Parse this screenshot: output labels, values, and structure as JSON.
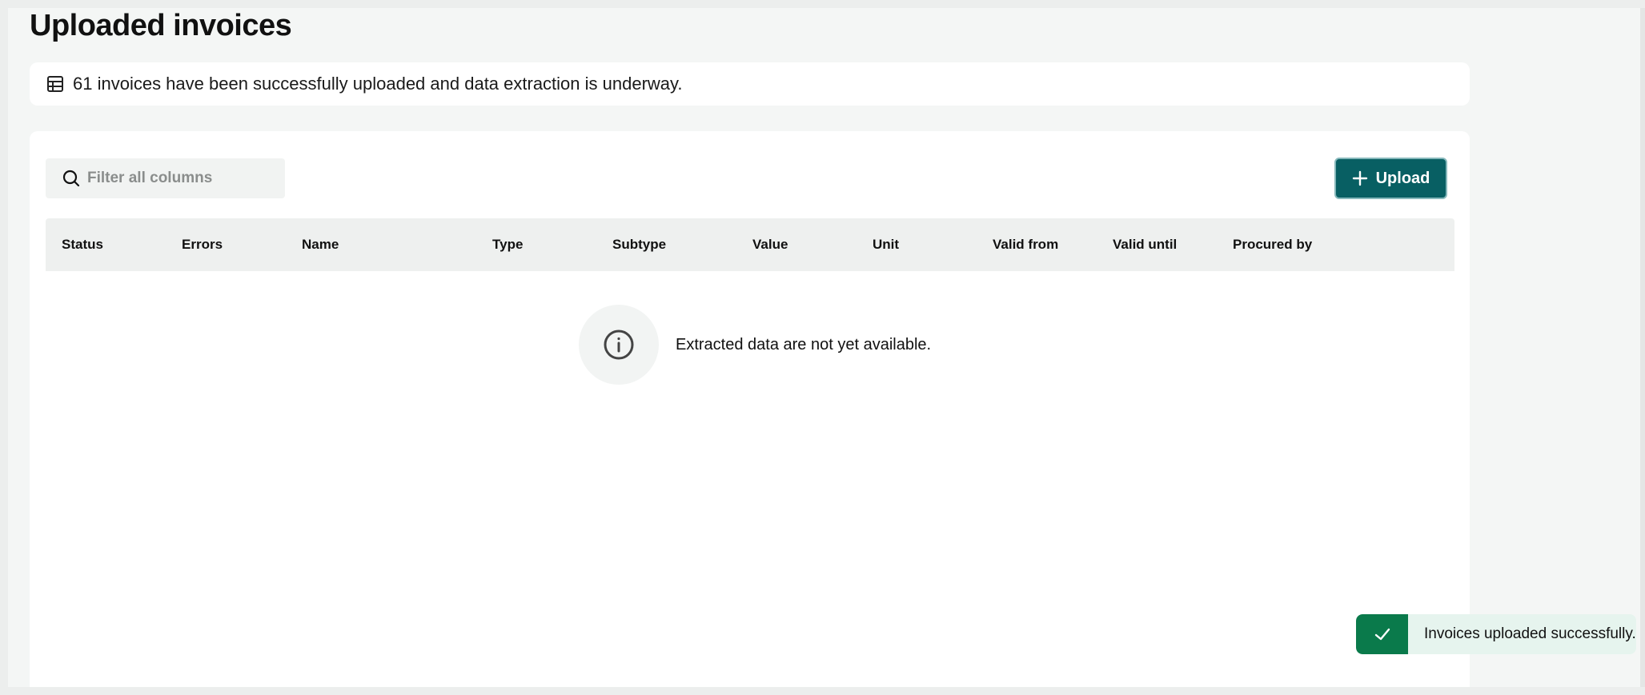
{
  "page": {
    "title": "Uploaded invoices"
  },
  "banner": {
    "icon": "table-icon",
    "message": "61 invoices have been successfully uploaded and data extraction is underway."
  },
  "toolbar": {
    "search_icon": "search-icon",
    "search_placeholder": "Filter all columns",
    "search_value": "",
    "upload_icon": "plus-icon",
    "upload_label": "Upload"
  },
  "table": {
    "columns": [
      {
        "label": "Status"
      },
      {
        "label": "Errors"
      },
      {
        "label": "Name"
      },
      {
        "label": "Type"
      },
      {
        "label": "Subtype"
      },
      {
        "label": "Value"
      },
      {
        "label": "Unit"
      },
      {
        "label": "Valid from"
      },
      {
        "label": "Valid until"
      },
      {
        "label": "Procured by"
      }
    ],
    "rows": [],
    "empty_icon": "info-icon",
    "empty_message": "Extracted data are not yet available."
  },
  "toast": {
    "icon": "check-icon",
    "message": "Invoices uploaded successfully.",
    "colors": {
      "badge": "#0a7a4b",
      "background": "#e6f4ee"
    }
  },
  "colors": {
    "accent": "#085f63"
  }
}
